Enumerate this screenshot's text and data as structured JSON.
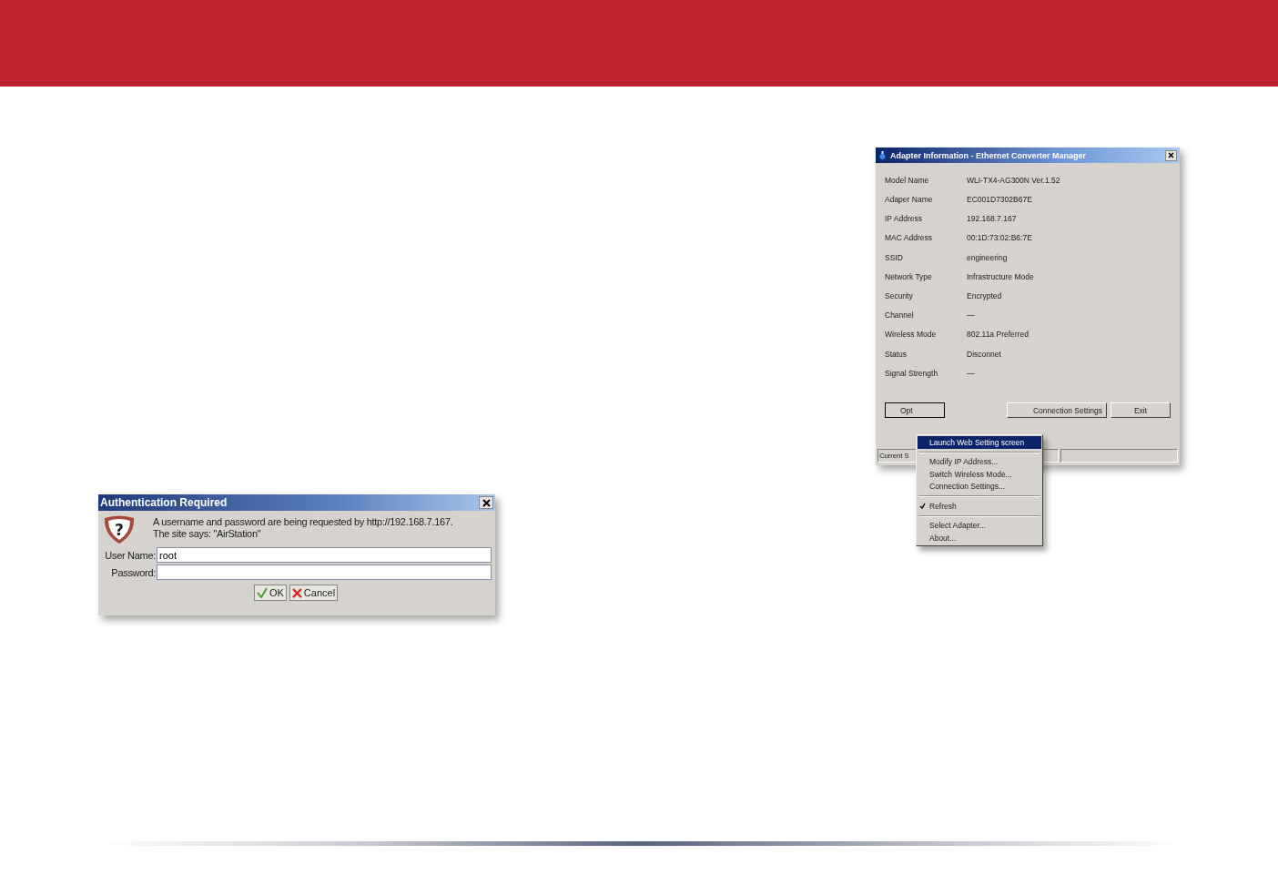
{
  "auth_dialog": {
    "title": "Authentication Required",
    "icon_glyph": "?",
    "message": "A username and password are being requested by http://192.168.7.167.\nThe site says: \"AirStation\"",
    "fields": [
      {
        "label": "User Name:",
        "value": "root"
      },
      {
        "label": "Password:"
      }
    ],
    "buttons": [
      {
        "kind": "ok",
        "label": "OK"
      },
      {
        "kind": "cancel",
        "label": "Cancel"
      }
    ]
  },
  "adapter_window": {
    "title": "Adapter Information - Ethernet Converter Manager",
    "info_groups": [
      [
        {
          "label": "Model Name",
          "value": "WLI-TX4-AG300N Ver.1.52"
        },
        {
          "label": "Adaper Name",
          "value": "EC001D7302B67E"
        },
        {
          "label": "IP Address",
          "value": "192.168.7.167"
        },
        {
          "label": "MAC Address",
          "value": "00:1D:73:02:B6:7E"
        }
      ],
      [
        {
          "label": "SSID",
          "value": "engineering"
        },
        {
          "label": "Network Type",
          "value": "Infrastructure Mode"
        },
        {
          "label": "Security",
          "value": "Encrypted"
        },
        {
          "label": "Channel",
          "value": "—"
        },
        {
          "label": "Wireless Mode",
          "value": "802.11a Preferred"
        }
      ],
      [
        {
          "label": "Status",
          "value": "Disconnet"
        },
        {
          "label": "Signal Strength",
          "value": "—"
        }
      ]
    ],
    "buttons": [
      {
        "label": "Opt"
      },
      {
        "label": "Connection Settings"
      },
      {
        "label": "Exit"
      }
    ],
    "status_bar": "Current S",
    "menu": [
      [
        {
          "label": "Launch Web Setting screen",
          "selected": true,
          "checked": false
        }
      ],
      [
        {
          "label": "Modify IP Address...",
          "selected": false,
          "checked": false
        },
        {
          "label": "Switch Wireless Mode...",
          "selected": false,
          "checked": false
        },
        {
          "label": "Connection Settings...",
          "selected": false,
          "checked": false
        }
      ],
      [
        {
          "label": "Refresh",
          "selected": false,
          "checked": true
        }
      ],
      [
        {
          "label": "Select Adapter...",
          "selected": false,
          "checked": false
        },
        {
          "label": "About...",
          "selected": false,
          "checked": false
        }
      ]
    ]
  }
}
